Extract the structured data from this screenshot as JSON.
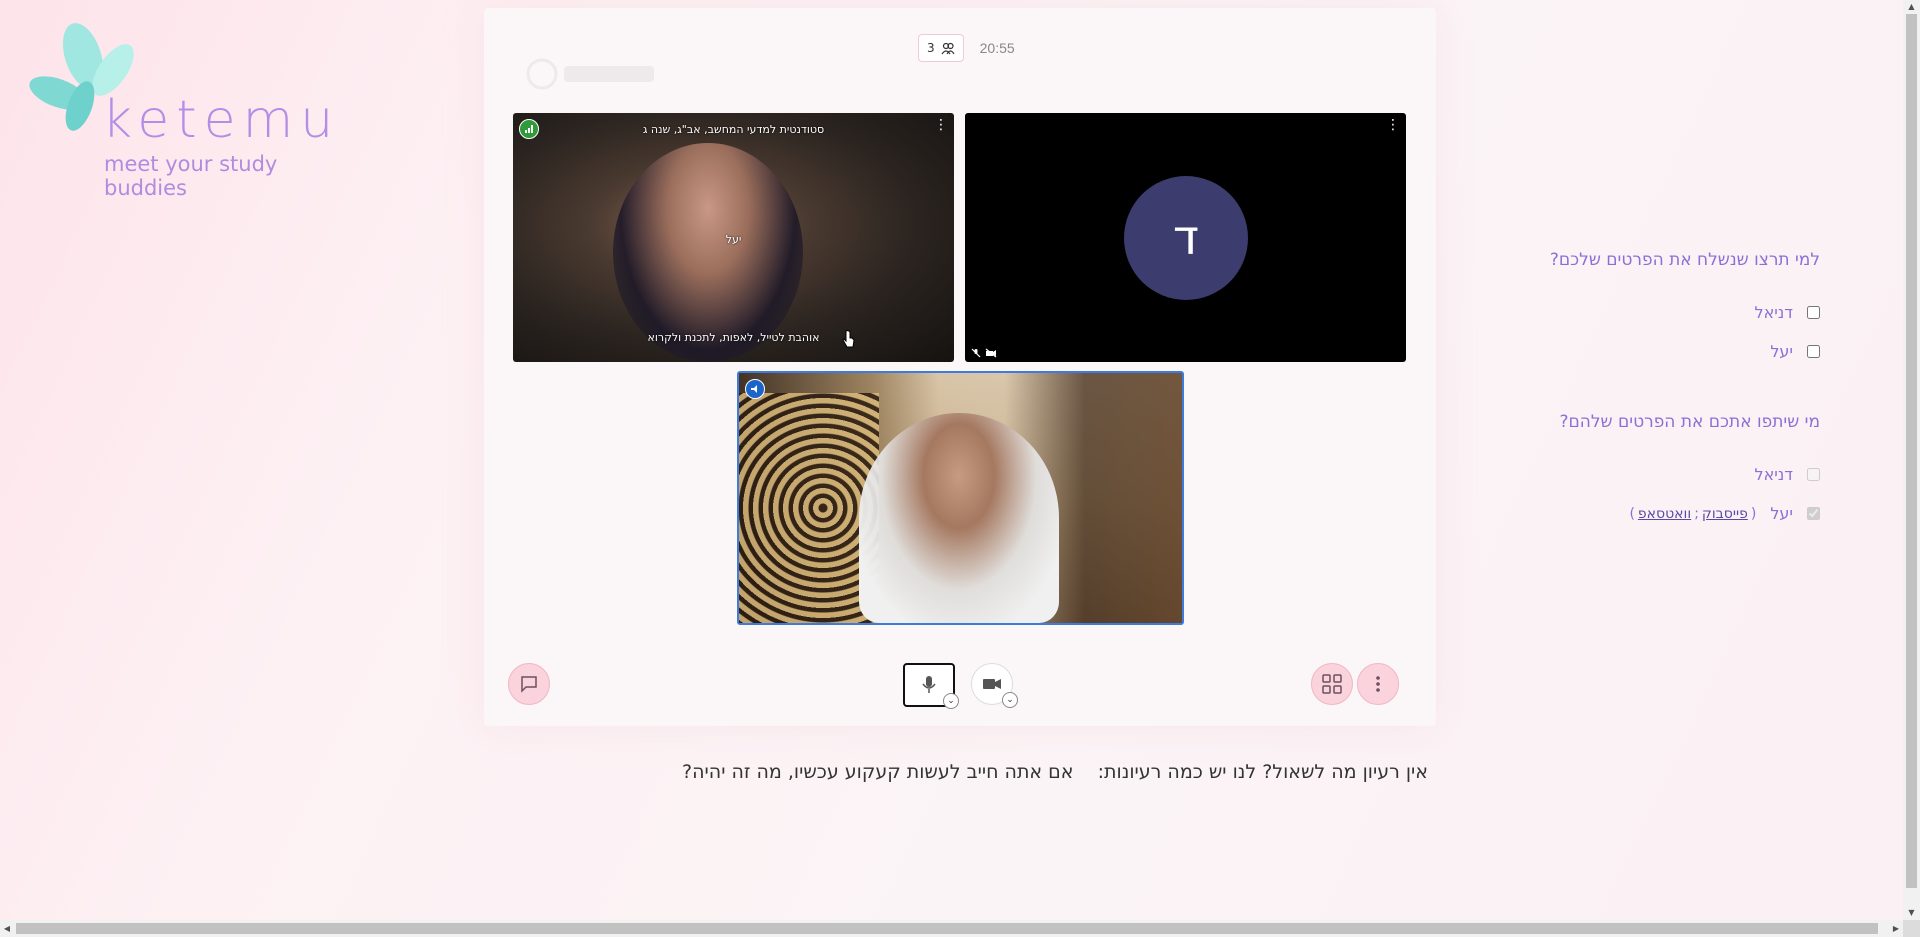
{
  "logo": {
    "wordmark": "ketemu",
    "tagline": "meet your study buddies"
  },
  "meeting": {
    "participant_count": "3",
    "timer": "20:55",
    "tiles": {
      "yael": {
        "title": "סטודנטית למדעי המחשב, אב\"ג, שנה ג",
        "name": "יעל",
        "bio": "אוהבת לטייל, לאפות, לתכנת ולקרוא"
      },
      "daniel": {
        "avatar_letter": "ד"
      },
      "self": {}
    }
  },
  "prompt": {
    "lead": "אין רעיון מה לשאול? לנו יש כמה רעיונות:",
    "question": "אם אתה חייב לעשות קעקוע עכשיו, מה זה יהיה?"
  },
  "panel": {
    "send_question": "למי תרצו שנשלח את הפרטים שלכם?",
    "send_options": [
      {
        "label": "דניאל",
        "checked": false
      },
      {
        "label": "יעל",
        "checked": false
      }
    ],
    "shared_question": "מי שיתפו אתכם את הפרטים שלהם?",
    "shared_options": [
      {
        "label": "דניאל",
        "checked": false,
        "disabled": true
      },
      {
        "label": "יעל",
        "checked": true,
        "disabled": true,
        "links": [
          "פייסבוק",
          "וואטסאפ"
        ],
        "open_paren": "(",
        "separator": ";",
        "close_paren": ")"
      }
    ]
  }
}
